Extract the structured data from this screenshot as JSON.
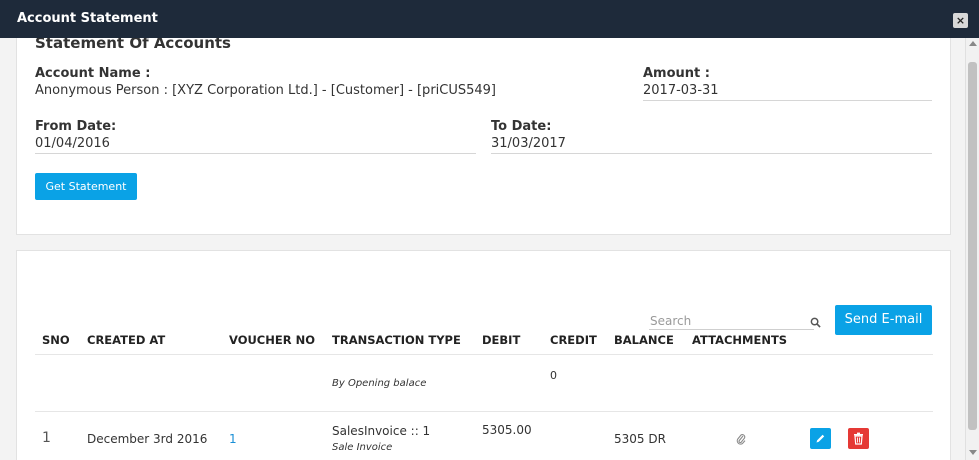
{
  "window": {
    "title": "Account Statement",
    "close_symbol": "×"
  },
  "statement": {
    "heading": "Statement Of Accounts",
    "account_name_label": "Account Name :",
    "account_name_value": "Anonymous Person : [XYZ Corporation Ltd.] - [Customer] - [priCUS549]",
    "amount_label": "Amount :",
    "amount_value": "2017-03-31",
    "from_date_label": "From Date:",
    "from_date_value": "01/04/2016",
    "to_date_label": "To Date:",
    "to_date_value": "31/03/2017",
    "get_statement_label": "Get Statement"
  },
  "table": {
    "search_placeholder": "Search",
    "send_email_label": "Send E-mail",
    "headers": [
      "SNO",
      "CREATED AT",
      "VOUCHER NO",
      "TRANSACTION TYPE",
      "DEBIT",
      "CREDIT",
      "BALANCE",
      "ATTACHMENTS"
    ],
    "opening_row": {
      "transaction_type": "By Opening balace",
      "credit": "0"
    },
    "rows": [
      {
        "sno": "1",
        "created_at": "December 3rd 2016",
        "voucher_no": "1",
        "transaction_type": "SalesInvoice :: 1",
        "transaction_subtype": "Sale Invoice",
        "debit": "5305.00",
        "balance": "5305 DR"
      }
    ]
  },
  "colors": {
    "titlebar": "#1e2a3a",
    "primary": "#0aa2e6",
    "danger": "#e53935",
    "link": "#1a8fd6"
  },
  "icons": [
    "close-icon",
    "search-icon",
    "paperclip-icon",
    "pencil-icon",
    "trash-icon"
  ]
}
